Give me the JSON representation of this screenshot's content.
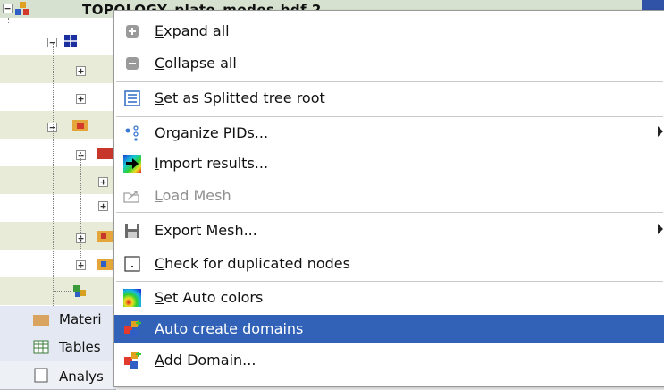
{
  "tree": {
    "root_title": "TOPOLOGY_plate_modes.bdf 2",
    "side_tabs": [
      {
        "label": "Materi"
      },
      {
        "label": "Tables"
      },
      {
        "label": "Analys"
      }
    ]
  },
  "menu": {
    "items": [
      {
        "label_mnemonic": "E",
        "label_rest": "xpand all",
        "icon": "expand-all-icon",
        "enabled": true
      },
      {
        "label_mnemonic": "C",
        "label_rest": "ollapse all",
        "icon": "collapse-all-icon",
        "enabled": true
      },
      {
        "label_mnemonic": "S",
        "label_rest": "et as Splitted tree root",
        "icon": "split-tree-icon",
        "enabled": true
      },
      {
        "label_mnemonic": "",
        "label_rest": "Organize PIDs...",
        "icon": "organize-pids-icon",
        "enabled": true,
        "submenu": true
      },
      {
        "label_mnemonic": "I",
        "label_rest": "mport results...",
        "icon": "import-arrow-icon",
        "enabled": true
      },
      {
        "label_mnemonic": "L",
        "label_rest": "oad Mesh",
        "icon": "load-mesh-icon",
        "enabled": false
      },
      {
        "label_mnemonic": "",
        "label_rest": "Export Mesh...",
        "icon": "floppy-disk-icon",
        "enabled": true,
        "submenu": true
      },
      {
        "label_mnemonic": "C",
        "label_rest": "heck for duplicated nodes",
        "icon": "duplicate-nodes-icon",
        "enabled": true
      },
      {
        "label_mnemonic": "S",
        "label_rest": "et Auto colors",
        "icon": "color-gradient-icon",
        "enabled": true
      },
      {
        "label_mnemonic": "",
        "label_rest": "Auto create domains",
        "icon": "auto-domains-icon",
        "enabled": true,
        "selected": true
      },
      {
        "label_mnemonic": "A",
        "label_rest": "dd Domain...",
        "icon": "add-domain-icon",
        "enabled": true
      }
    ]
  },
  "colors": {
    "selection": "#3162b8",
    "root_row": "#d6e2cf",
    "tree_alt_row": "#e9ebd9",
    "disabled_text": "#8f8f8f"
  }
}
